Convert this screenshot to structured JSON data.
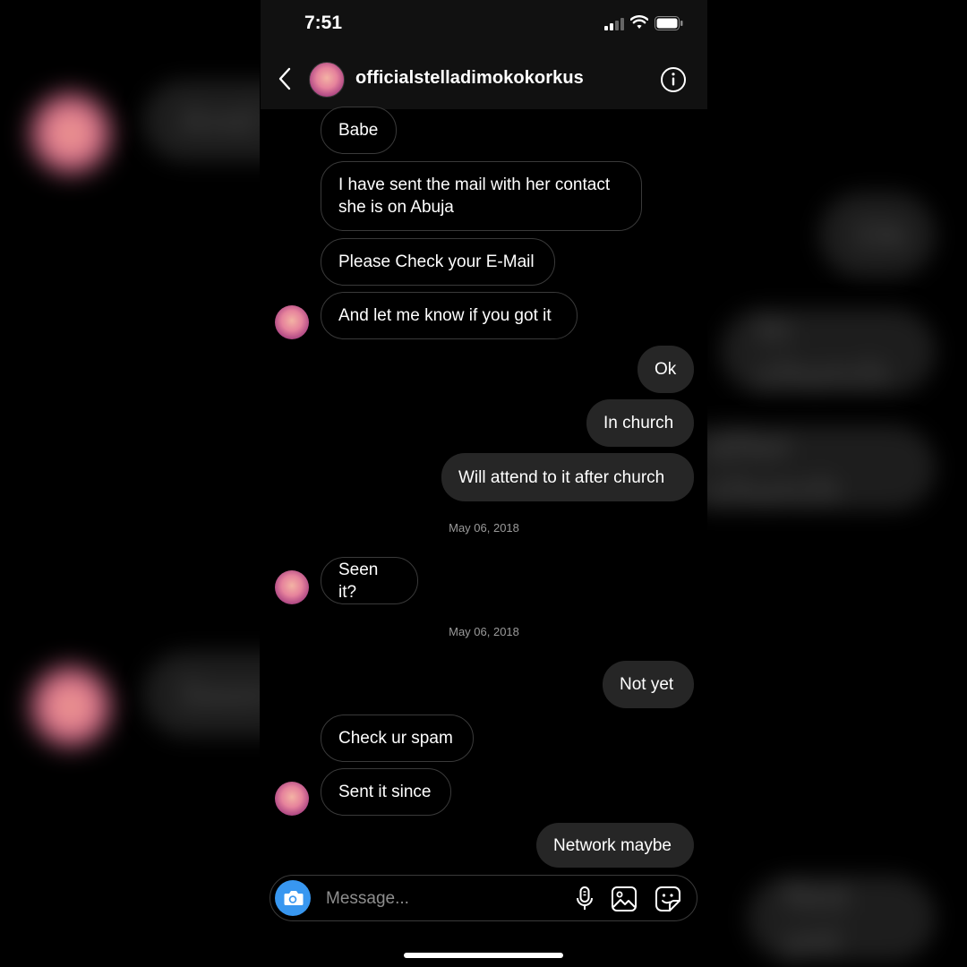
{
  "status_bar": {
    "time": "7:51"
  },
  "header": {
    "username": "officialstelladimokokorkus"
  },
  "messages": [
    {
      "text": "Babe"
    },
    {
      "text": "I have sent the mail with her contact\nshe is on Abuja"
    },
    {
      "text": "Please Check your E-Mail"
    },
    {
      "text": "And let me know if you got it"
    },
    {
      "text": "Ok"
    },
    {
      "text": "In church"
    },
    {
      "text": "Will attend to it after church"
    },
    {
      "text": "Seen it?"
    },
    {
      "text": "Not yet"
    },
    {
      "text": "Check ur spam"
    },
    {
      "text": "Sent it since"
    },
    {
      "text": "Network maybe"
    }
  ],
  "date_stamps": [
    "May 06, 2018",
    "May 06, 2018"
  ],
  "composer": {
    "placeholder": "Message..."
  },
  "backdrop": {
    "right_bubbles": [
      "Ok",
      "In church",
      "after church",
      "Not yet"
    ],
    "left_bubbles": [
      "And l",
      "Seen"
    ]
  },
  "colors": {
    "accent": "#3897f0",
    "outgoing_bubble": "#262626",
    "header_bg": "#111111"
  }
}
